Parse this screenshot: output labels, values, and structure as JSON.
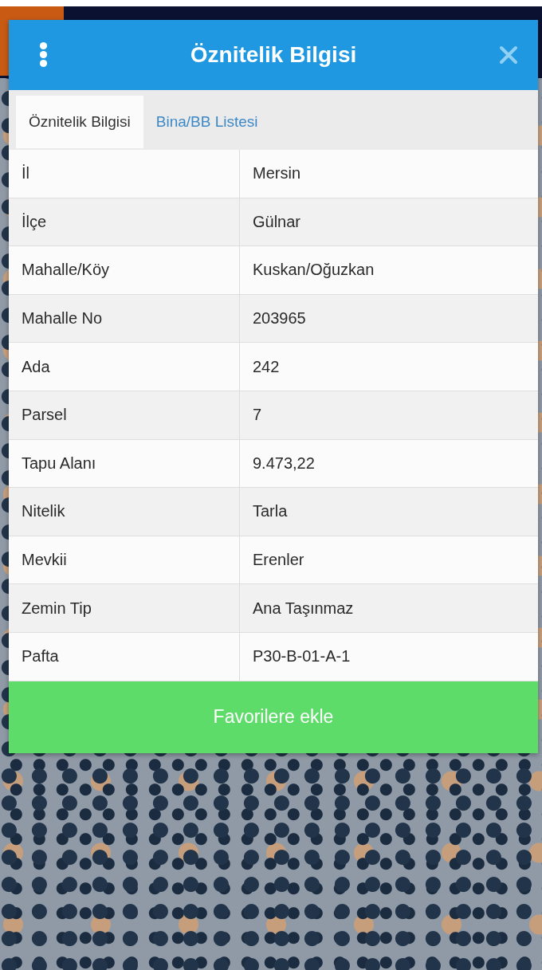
{
  "dialog": {
    "title": "Öznitelik Bilgisi"
  },
  "tabs": [
    {
      "label": "Öznitelik Bilgisi",
      "selected": true
    },
    {
      "label": "Bina/BB Listesi",
      "selected": false
    }
  ],
  "table": {
    "rows": [
      {
        "label": "İl",
        "value": "Mersin"
      },
      {
        "label": "İlçe",
        "value": "Gülnar"
      },
      {
        "label": "Mahalle/Köy",
        "value": "Kuskan/Oğuzkan"
      },
      {
        "label": "Mahalle No",
        "value": "203965"
      },
      {
        "label": "Ada",
        "value": "242"
      },
      {
        "label": "Parsel",
        "value": "7"
      },
      {
        "label": "Tapu Alanı",
        "value": "9.473,22"
      },
      {
        "label": "Nitelik",
        "value": "Tarla"
      },
      {
        "label": "Mevkii",
        "value": "Erenler"
      },
      {
        "label": "Zemin Tip",
        "value": "Ana Taşınmaz"
      },
      {
        "label": "Pafta",
        "value": "P30-B-01-A-1"
      }
    ]
  },
  "button": {
    "label": "Favorilere ekle"
  }
}
